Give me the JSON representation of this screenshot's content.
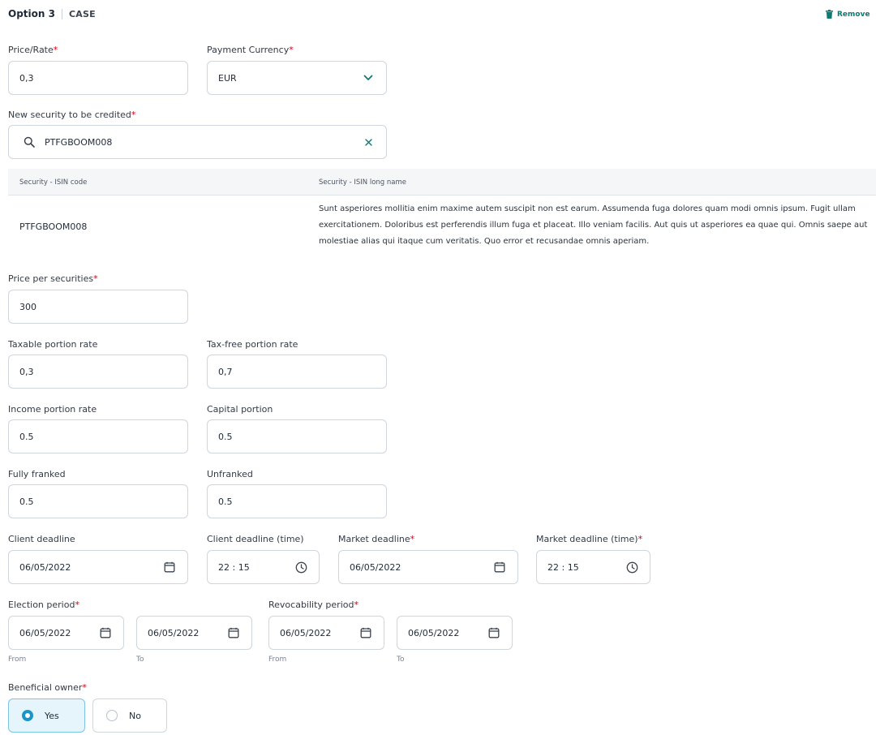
{
  "header": {
    "option_label": "Option 3",
    "type_label": "CASE",
    "remove_label": "Remove"
  },
  "price_rate": {
    "label": "Price/Rate",
    "value": "0,3"
  },
  "payment_currency": {
    "label": "Payment Currency",
    "value": "EUR"
  },
  "new_security": {
    "label": "New security to be credited",
    "value": "PTFGBOOM008"
  },
  "security_table": {
    "col_code": "Security - ISIN code",
    "col_name": "Security - ISIN long name",
    "rows": [
      {
        "code": "PTFGBOOM008",
        "name": "Sunt asperiores mollitia enim maxime autem suscipit non est earum. Assumenda fuga dolores quam modi omnis ipsum. Fugit ullam exercitationem. Doloribus est perferendis illum fuga et placeat. Illo veniam facilis. Aut quis ut asperiores ea quae qui. Omnis saepe aut molestiae alias qui itaque cum veritatis. Quo error et recusandae omnis aperiam."
      }
    ]
  },
  "price_per_securities": {
    "label": "Price per securities",
    "value": "300"
  },
  "taxable_portion_rate": {
    "label": "Taxable portion rate",
    "value": "0,3"
  },
  "tax_free_portion_rate": {
    "label": "Tax-free portion rate",
    "value": "0,7"
  },
  "income_portion_rate": {
    "label": "Income portion rate",
    "value": "0.5"
  },
  "capital_portion": {
    "label": "Capital portion",
    "value": "0.5"
  },
  "fully_franked": {
    "label": "Fully franked",
    "value": "0.5"
  },
  "unfranked": {
    "label": "Unfranked",
    "value": "0.5"
  },
  "client_deadline": {
    "label": "Client deadline",
    "value": "06/05/2022"
  },
  "client_deadline_time": {
    "label": "Client deadline (time)",
    "value": "22 : 15"
  },
  "market_deadline": {
    "label": "Market deadline",
    "value": "06/05/2022"
  },
  "market_deadline_time": {
    "label": "Market deadline (time)",
    "value": "22 : 15"
  },
  "election_period": {
    "label": "Election period",
    "from": "06/05/2022",
    "to": "06/05/2022",
    "from_label": "From",
    "to_label": "To"
  },
  "revocability_period": {
    "label": "Revocability period",
    "from": "06/05/2022",
    "to": "06/05/2022",
    "from_label": "From",
    "to_label": "To"
  },
  "beneficial_owner": {
    "label": "Beneficial owner",
    "yes_label": "Yes",
    "no_label": "No",
    "selected": "Yes"
  },
  "required_marker": "*",
  "colors": {
    "accent": "#0e7a70",
    "required": "#d0021b",
    "selected_bg": "#e6f4fb",
    "selected_border": "#7cc4e6",
    "radio_selected": "#1a95c9"
  },
  "icons": {
    "remove": "trash-icon",
    "currency": "chevron-down-icon",
    "search": "search-icon",
    "clear": "close-icon",
    "date": "calendar-icon",
    "time": "clock-icon"
  }
}
